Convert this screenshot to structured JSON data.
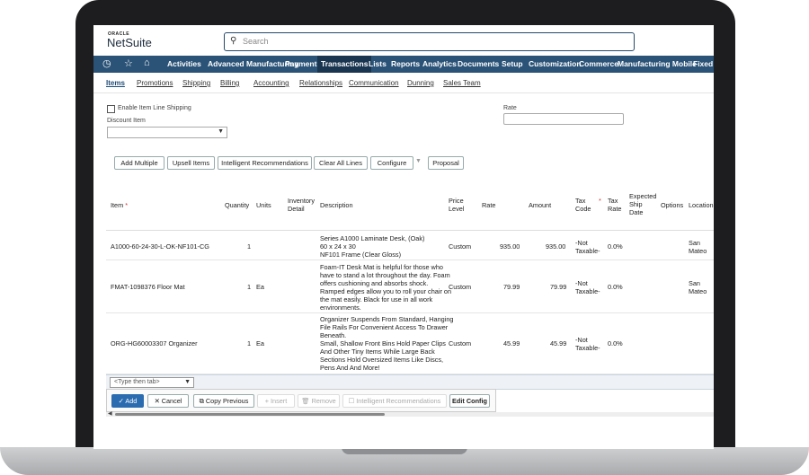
{
  "app": {
    "oracle": "ORACLE",
    "name": "NetSuite"
  },
  "search": {
    "placeholder": "Search"
  },
  "nav": {
    "items": [
      "Activities",
      "Advanced Manufacturing",
      "Payments",
      "Transactions",
      "Lists",
      "Reports",
      "Analytics",
      "Documents",
      "Setup",
      "Customization",
      "Commerce",
      "Manufacturing Mobile",
      "Fixed A"
    ],
    "active": "Transactions"
  },
  "subtabs": [
    "Items",
    "Promotions",
    "Shipping",
    "Billing",
    "Accounting",
    "Relationships",
    "Communication",
    "Dunning",
    "Sales Team"
  ],
  "form": {
    "enable_line_shipping": "Enable Item Line Shipping",
    "discount_item": "Discount Item",
    "rate": "Rate"
  },
  "buttons": {
    "add_multiple": "Add Multiple",
    "upsell_items": "Upsell Items",
    "intelligent_recommendations": "Intelligent Recommendations",
    "clear_all_lines": "Clear All Lines",
    "configure": "Configure",
    "proposal": "Proposal"
  },
  "table": {
    "headers": {
      "item": "Item",
      "quantity": "Quantity",
      "units": "Units",
      "inventory_detail_1": "Inventory",
      "inventory_detail_2": "Detail",
      "description": "Description",
      "price_level_1": "Price",
      "price_level_2": "Level",
      "rate": "Rate",
      "amount": "Amount",
      "tax_code_1": "Tax",
      "tax_code_2": "Code",
      "tax_rate_1": "Tax",
      "tax_rate_2": "Rate",
      "exp_ship_1": "Expected",
      "exp_ship_2": "Ship",
      "exp_ship_3": "Date",
      "options": "Options",
      "location": "Location"
    },
    "rows": [
      {
        "item": "A1000-60-24-30-L-OK-NF101-CG",
        "quantity": "1",
        "units": "",
        "desc": [
          "Series A1000 Laminate Desk, (Oak)",
          "60 x 24 x 30",
          "NF101 Frame (Clear Gloss)"
        ],
        "price_level": "Custom",
        "rate": "935.00",
        "amount": "935.00",
        "tax_code_1": "-Not",
        "tax_code_2": "Taxable-",
        "tax_rate": "0.0%",
        "location_1": "San",
        "location_2": "Mateo"
      },
      {
        "item": "FMAT-1098376 Floor Mat",
        "quantity": "1",
        "units": "Ea",
        "desc": [
          "Foam-IT Desk Mat is helpful for those who",
          "have to stand a lot throughout the day. Foam",
          "offers cushioning and absorbs shock.",
          "Ramped edges allow you to roll your chair on",
          "the mat easily. Black for use in all work",
          "environments."
        ],
        "price_level": "Custom",
        "rate": "79.99",
        "amount": "79.99",
        "tax_code_1": "-Not",
        "tax_code_2": "Taxable-",
        "tax_rate": "0.0%",
        "location_1": "San",
        "location_2": "Mateo"
      },
      {
        "item": "ORG-HG60003307 Organizer",
        "quantity": "1",
        "units": "Ea",
        "desc": [
          "Organizer Suspends From Standard, Hanging",
          "File Rails For Convenient Access To Drawer",
          "Beneath.",
          "Small, Shallow Front Bins Hold Paper Clips",
          "And Other Tiny Items While Large Back",
          "Sections Hold Oversized Items Like Discs,",
          "Pens And And More!"
        ],
        "price_level": "Custom",
        "rate": "45.99",
        "amount": "45.99",
        "tax_code_1": "-Not",
        "tax_code_2": "Taxable-",
        "tax_rate": "0.0%",
        "location_1": "",
        "location_2": ""
      }
    ]
  },
  "entry": {
    "placeholder": "<Type then tab>"
  },
  "actions": {
    "add": "Add",
    "cancel": "Cancel",
    "copy_previous": "Copy Previous",
    "insert": "Insert",
    "remove": "Remove",
    "intelligent_recommendations": "Intelligent Recommendations",
    "edit_config": "Edit Config"
  }
}
